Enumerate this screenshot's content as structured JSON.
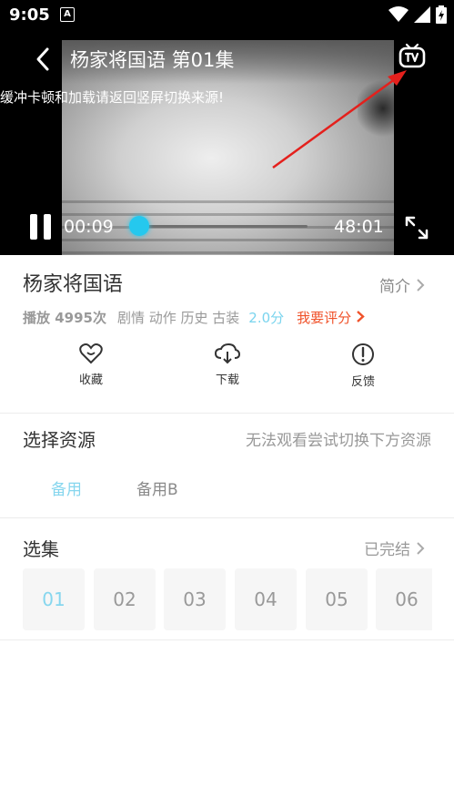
{
  "status_bar": {
    "time": "9:05",
    "notification_glyph": "A"
  },
  "player": {
    "title": "杨家将国语 第01集",
    "notice": "缓冲卡顿和加载请返回竖屏切换来源!",
    "current_time": "00:09",
    "total_time": "48:01",
    "progress": 0.003,
    "accent_color": "#25c8ee"
  },
  "show": {
    "title": "杨家将国语",
    "intro_label": "简介",
    "plays": "播放 4995次",
    "tags": "剧情 动作 历史 古装",
    "score": "2.0分",
    "rate_label": "我要评分"
  },
  "actions": [
    {
      "label": "收藏",
      "icon": "heart-icon"
    },
    {
      "label": "下载",
      "icon": "cloud-download-icon"
    },
    {
      "label": "反馈",
      "icon": "alert-icon"
    }
  ],
  "sources": {
    "title": "选择资源",
    "hint": "无法观看尝试切换下方资源",
    "items": [
      "备用",
      "备用B"
    ]
  },
  "episodes_section": {
    "title": "选集",
    "status": "已完结",
    "items": [
      "01",
      "02",
      "03",
      "04",
      "05",
      "06"
    ]
  }
}
